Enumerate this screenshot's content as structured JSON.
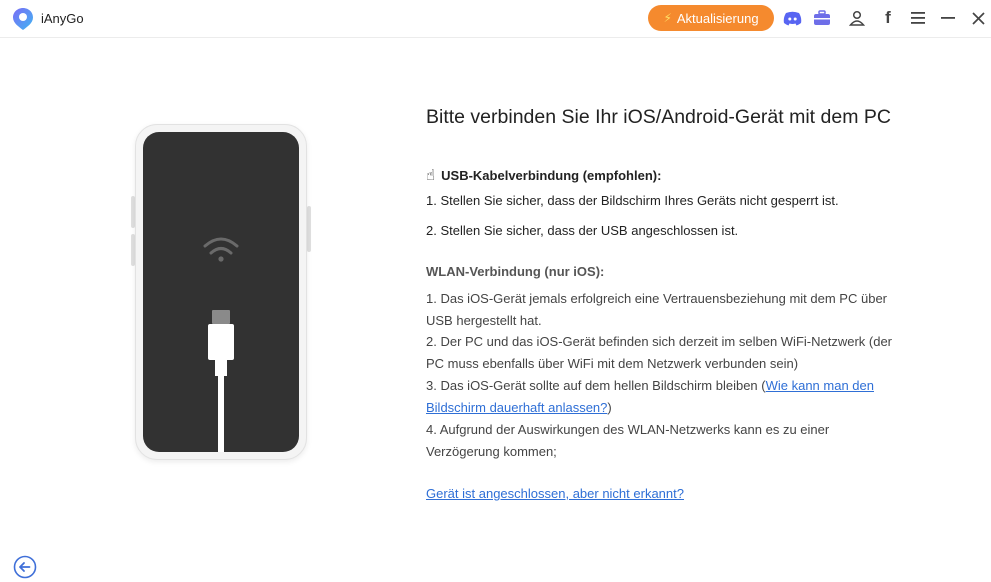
{
  "app": {
    "name": "iAnyGo"
  },
  "header": {
    "update_label": "Aktualisierung",
    "icons": [
      "discord-icon",
      "toolbox-icon",
      "user-icon",
      "facebook-icon",
      "menu-icon",
      "minimize-icon",
      "close-icon"
    ]
  },
  "main": {
    "title": "Bitte verbinden Sie Ihr iOS/Android-Gerät mit dem PC",
    "usb": {
      "heading": "USB-Kabelverbindung (empfohlen):",
      "steps": [
        "1. Stellen Sie sicher, dass der Bildschirm Ihres Geräts nicht gesperrt ist.",
        "2. Stellen Sie sicher, dass der USB angeschlossen ist."
      ]
    },
    "wlan": {
      "heading": "WLAN-Verbindung (nur iOS):",
      "step1": "1. Das iOS-Gerät jemals erfolgreich eine Vertrauensbeziehung mit dem PC über USB hergestellt hat.",
      "step2": "2. Der PC und das iOS-Gerät befinden sich derzeit im selben WiFi-Netzwerk (der PC muss ebenfalls über WiFi mit dem Netzwerk verbunden sein)",
      "step3_prefix": "3. Das iOS-Gerät sollte auf dem hellen Bildschirm bleiben  (",
      "step3_link": "Wie kann man den Bildschirm dauerhaft anlassen?",
      "step3_suffix": ")",
      "step4": "4. Aufgrund der Auswirkungen des WLAN-Netzwerks kann es zu einer Verzögerung kommen;"
    },
    "not_recognized_link": "Gerät ist angeschlossen, aber nicht erkannt?"
  },
  "colors": {
    "accent": "#f58a2e",
    "link": "#2f6fd6",
    "phone_screen": "#323232"
  }
}
